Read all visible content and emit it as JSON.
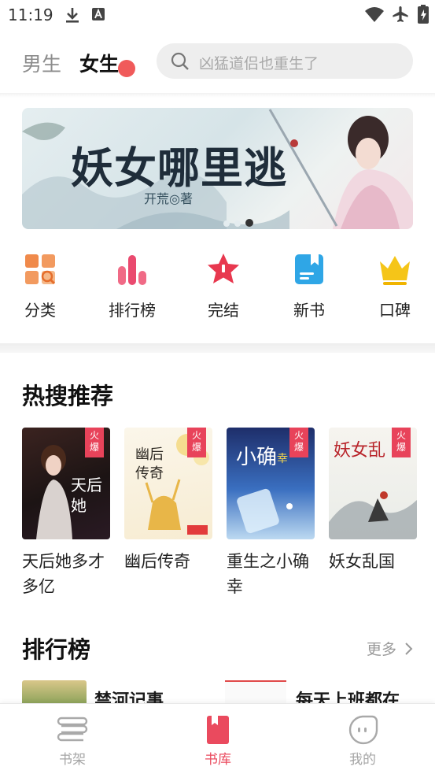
{
  "status_bar": {
    "time": "11:19",
    "left_icons": [
      "download-icon",
      "font-a-icon"
    ],
    "right_icons": [
      "wifi-icon",
      "airplane-icon",
      "battery-charging-icon"
    ]
  },
  "header": {
    "tabs": [
      {
        "label": "男生",
        "active": false
      },
      {
        "label": "女生",
        "active": true
      }
    ],
    "search": {
      "placeholder": "凶猛道侣也重生了",
      "icon": "search-icon"
    }
  },
  "banner": {
    "title": "妖女哪里逃",
    "author": "开荒◎著",
    "slide_count": 3,
    "active_slide": 3
  },
  "quick_nav": [
    {
      "label": "分类",
      "icon": "category-grid-icon",
      "color": "#f08a4b"
    },
    {
      "label": "排行榜",
      "icon": "ranking-bars-icon",
      "color": "#ea4a6f"
    },
    {
      "label": "完结",
      "icon": "star-icon",
      "color": "#e8384f"
    },
    {
      "label": "新书",
      "icon": "new-book-icon",
      "color": "#2fa6e6"
    },
    {
      "label": "口碑",
      "icon": "crown-icon",
      "color": "#f5c518"
    }
  ],
  "hot_section": {
    "title": "热搜推荐",
    "books": [
      {
        "title": "天后她多才多亿",
        "badge": "火爆",
        "cover_text": "天后她多才多亿"
      },
      {
        "title": "幽后传奇",
        "badge": "火爆",
        "cover_text": "幽后传奇"
      },
      {
        "title": "重生之小确幸",
        "badge": "火爆",
        "cover_text": "小确幸"
      },
      {
        "title": "妖女乱国",
        "badge": "火爆",
        "cover_text": "妖女乱国"
      }
    ]
  },
  "ranking_section": {
    "title": "排行榜",
    "more_label": "更多",
    "peek_items": [
      "禁河记事",
      "每天上班都在"
    ]
  },
  "bottom_nav": [
    {
      "label": "书架",
      "icon": "bookshelf-icon",
      "active": false
    },
    {
      "label": "书库",
      "icon": "library-bookmark-icon",
      "active": true
    },
    {
      "label": "我的",
      "icon": "profile-face-icon",
      "active": false
    }
  ],
  "colors": {
    "accent": "#ea4a5e",
    "badge": "#e8435a",
    "tab_dot": "#f05a5a"
  }
}
